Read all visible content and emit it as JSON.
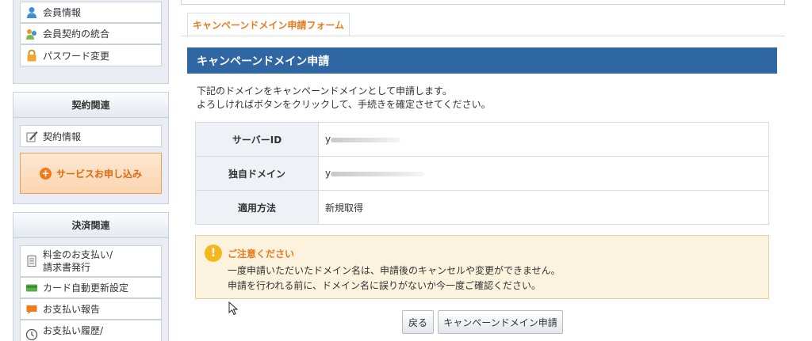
{
  "sidebar": {
    "account_items": [
      {
        "label": "会員情報",
        "icon": "user-icon"
      },
      {
        "label": "会員契約の統合",
        "icon": "merge-users-icon"
      },
      {
        "label": "パスワード変更",
        "icon": "lock-icon"
      }
    ],
    "contract": {
      "header": "契約関連",
      "items": [
        {
          "label": "契約情報",
          "icon": "pen-document-icon"
        }
      ],
      "service_button": "サービスお申し込み"
    },
    "payment": {
      "header": "決済関連",
      "items": [
        {
          "label_line1": "料金のお支払い/",
          "label_line2": "請求書発行",
          "icon": "invoice-icon"
        },
        {
          "label": "カード自動更新設定",
          "icon": "credit-card-icon"
        },
        {
          "label": "お支払い報告",
          "icon": "chat-icon"
        },
        {
          "label": "お支払い履歴/",
          "icon": "clock-icon"
        }
      ]
    }
  },
  "tab": {
    "label": "キャンペーンドメイン申請フォーム"
  },
  "main": {
    "title": "キャンペーンドメイン申請",
    "description_line1": "下記のドメインをキャンペーンドメインとして申請します。",
    "description_line2": "よろしければボタンをクリックして、手続きを確定させてください。",
    "rows": [
      {
        "label": "サーバーID",
        "value": "y"
      },
      {
        "label": "独自ドメイン",
        "value": "y"
      },
      {
        "label": "適用方法",
        "value": "新規取得"
      }
    ],
    "notice": {
      "title": "ご注意ください",
      "line1": "一度申請いただいたドメイン名は、申請後のキャンセルや変更ができません。",
      "line2": "申請を行われる前に、ドメイン名に誤りがないか今一度ご確認ください。"
    },
    "buttons": {
      "back": "戻る",
      "apply": "キャンペーンドメイン申請"
    }
  },
  "colors": {
    "title_bar": "#2f66a4",
    "accent_orange": "#e87b1e",
    "notice_bg": "#fbf3de"
  }
}
